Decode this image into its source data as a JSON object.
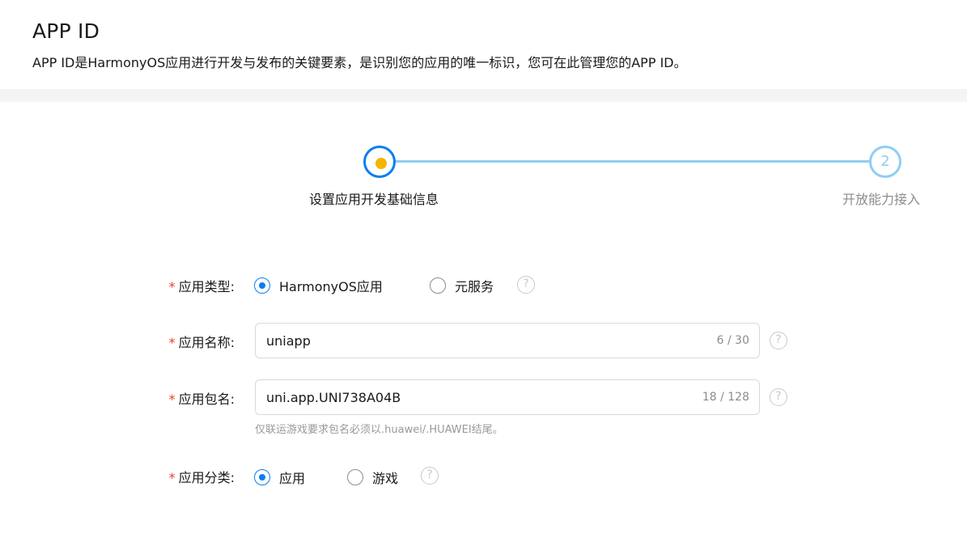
{
  "header": {
    "title": "APP ID",
    "description": "APP ID是HarmonyOS应用进行开发与发布的关键要素，是识别您的应用的唯一标识，您可在此管理您的APP ID。"
  },
  "stepper": {
    "steps": [
      {
        "number": "",
        "label": "设置应用开发基础信息",
        "status": "current"
      },
      {
        "number": "2",
        "label": "开放能力接入",
        "status": "pending"
      }
    ]
  },
  "form": {
    "required_mark": "*",
    "app_type": {
      "label": "应用类型:",
      "options": [
        "HarmonyOS应用",
        "元服务"
      ],
      "selected": "HarmonyOS应用"
    },
    "app_name": {
      "label": "应用名称:",
      "value": "uniapp",
      "counter": "6 / 30"
    },
    "package_name": {
      "label": "应用包名:",
      "value": "uni.app.UNI738A04B",
      "counter": "18 / 128",
      "hint": "仅联运游戏要求包名必须以.huawei/.HUAWEI结尾。"
    },
    "app_category": {
      "label": "应用分类:",
      "options": [
        "应用",
        "游戏"
      ],
      "selected": "应用"
    },
    "help_glyph": "?"
  },
  "colors": {
    "primary": "#0a7ef0",
    "step_line": "#8fcdf5",
    "current_dot": "#f7b500",
    "required": "#e84026"
  }
}
